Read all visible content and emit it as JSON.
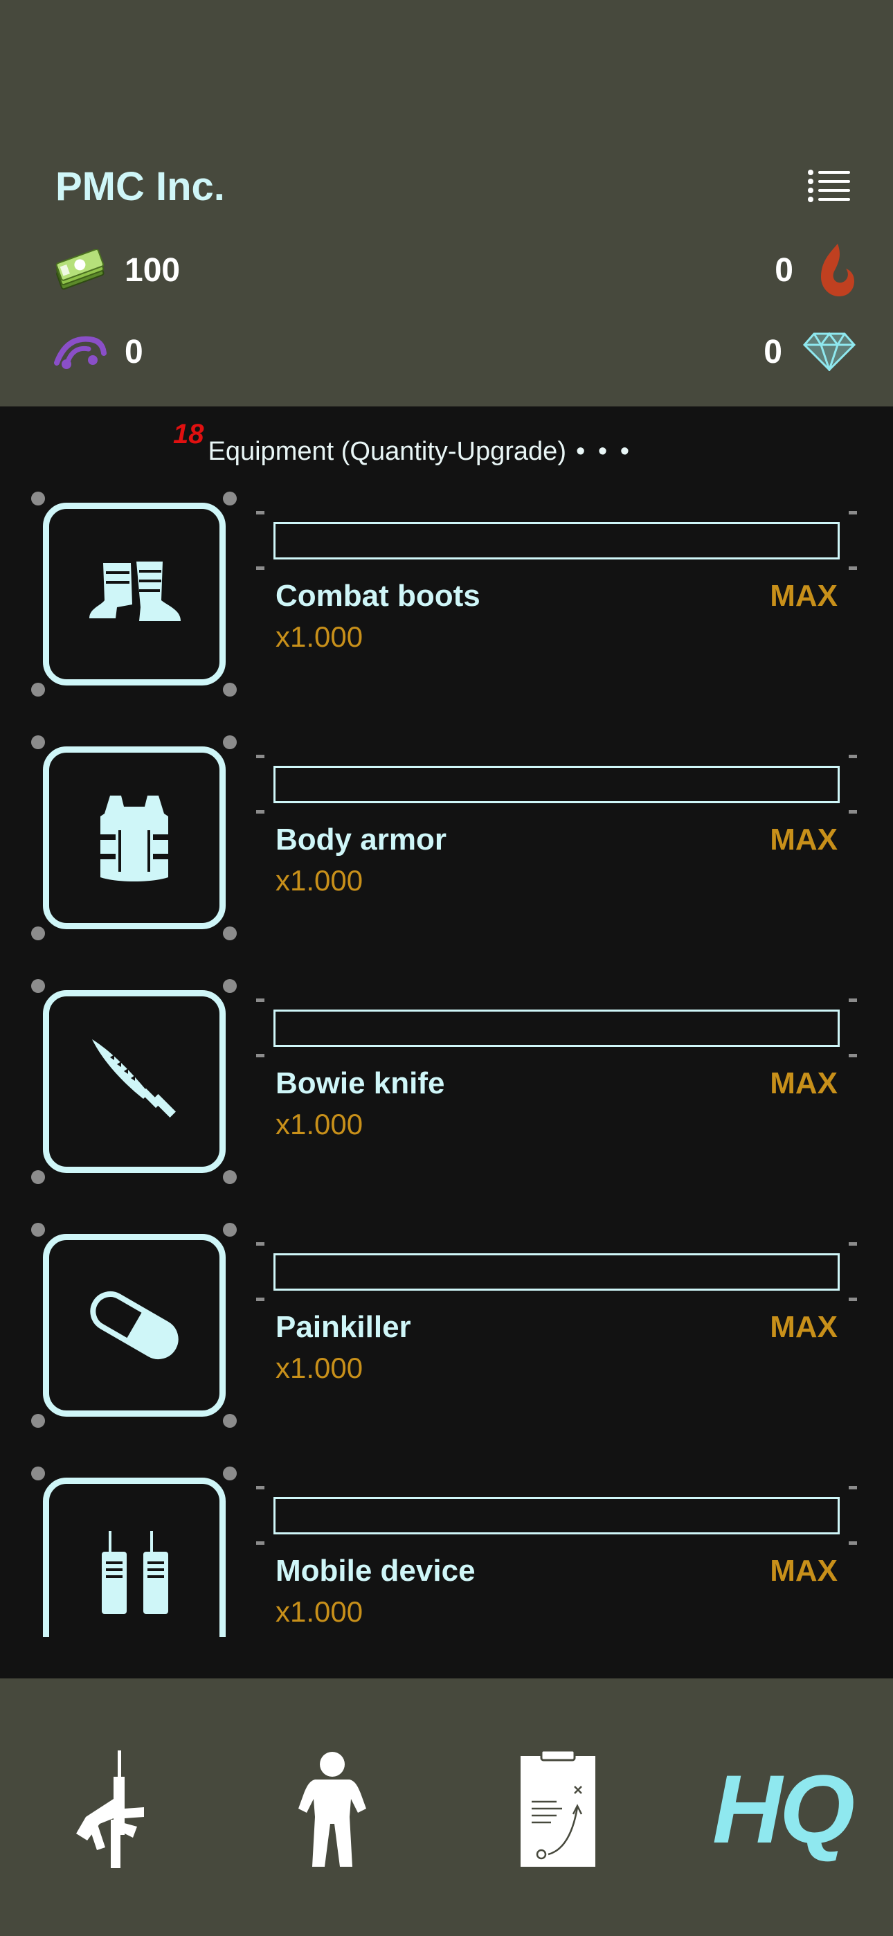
{
  "header": {
    "company_name": "PMC Inc.",
    "menu_icon": "list-icon",
    "stats": {
      "money": {
        "icon": "cash-icon",
        "value": "100"
      },
      "rank": {
        "icon": "rank-icon",
        "value": "0"
      },
      "fire": {
        "icon": "flame-icon",
        "value": "0"
      },
      "gems": {
        "icon": "diamond-icon",
        "value": "0"
      }
    }
  },
  "section": {
    "badge": "18",
    "title": "Equipment (Quantity-Upgrade)",
    "more": "• • •"
  },
  "items": [
    {
      "name": "Combat boots",
      "status": "MAX",
      "multiplier": "x1.000",
      "icon": "boots-icon",
      "progress": 0
    },
    {
      "name": "Body armor",
      "status": "MAX",
      "multiplier": "x1.000",
      "icon": "vest-icon",
      "progress": 0
    },
    {
      "name": "Bowie knife",
      "status": "MAX",
      "multiplier": "x1.000",
      "icon": "knife-icon",
      "progress": 0
    },
    {
      "name": "Painkiller",
      "status": "MAX",
      "multiplier": "x1.000",
      "icon": "pill-icon",
      "progress": 0
    },
    {
      "name": "Mobile device",
      "status": "MAX",
      "multiplier": "x1.000",
      "icon": "radio-icon",
      "progress": 0
    }
  ],
  "tabbar": {
    "tabs": [
      {
        "id": "weapons",
        "icon": "rifle-icon"
      },
      {
        "id": "character",
        "icon": "soldier-icon"
      },
      {
        "id": "missions",
        "icon": "clipboard-icon"
      },
      {
        "id": "hq",
        "label": "HQ"
      }
    ]
  },
  "colors": {
    "header_bg": "#47493d",
    "list_bg": "#121212",
    "accent": "#cff6f8",
    "gold": "#c8901a",
    "badge_red": "#e01010"
  }
}
